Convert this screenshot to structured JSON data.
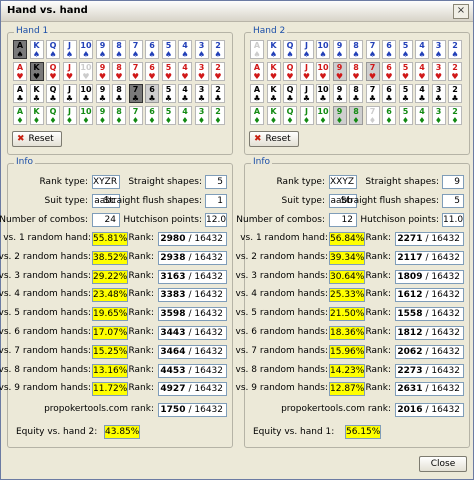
{
  "window": {
    "title": "Hand vs. hand",
    "close_glyph": "×",
    "close_label": "Close"
  },
  "hand1": {
    "label": "Hand 1",
    "reset_label": "Reset",
    "rows": [
      {
        "suit": "♠",
        "color": "blu",
        "cards": [
          "A",
          "K",
          "Q",
          "J",
          "10",
          "9",
          "8",
          "7",
          "6",
          "5",
          "4",
          "3",
          "2"
        ],
        "sel": [
          0
        ],
        "dim": [],
        "light": []
      },
      {
        "suit": "♥",
        "color": "red",
        "cards": [
          "A",
          "K",
          "Q",
          "J",
          "10",
          "9",
          "8",
          "7",
          "6",
          "5",
          "4",
          "3",
          "2"
        ],
        "sel": [
          1
        ],
        "dim": [],
        "light": [
          4
        ]
      },
      {
        "suit": "♣",
        "color": "blk",
        "cards": [
          "A",
          "K",
          "Q",
          "J",
          "10",
          "9",
          "8",
          "7",
          "6",
          "5",
          "4",
          "3",
          "2"
        ],
        "sel": [
          7
        ],
        "dim": [
          8
        ],
        "light": []
      },
      {
        "suit": "♦",
        "color": "grn",
        "cards": [
          "A",
          "K",
          "Q",
          "J",
          "10",
          "9",
          "8",
          "7",
          "6",
          "5",
          "4",
          "3",
          "2"
        ],
        "sel": [],
        "dim": [],
        "light": []
      }
    ]
  },
  "hand2": {
    "label": "Hand 2",
    "reset_label": "Reset",
    "rows": [
      {
        "suit": "♠",
        "color": "blu",
        "cards": [
          "A",
          "K",
          "Q",
          "J",
          "10",
          "9",
          "8",
          "7",
          "6",
          "5",
          "4",
          "3",
          "2"
        ],
        "sel": [],
        "dim": [],
        "light": [
          0
        ]
      },
      {
        "suit": "♥",
        "color": "red",
        "cards": [
          "A",
          "K",
          "Q",
          "J",
          "10",
          "9",
          "8",
          "7",
          "6",
          "5",
          "4",
          "3",
          "2"
        ],
        "sel": [],
        "dim": [
          5,
          7
        ],
        "light": []
      },
      {
        "suit": "♣",
        "color": "blk",
        "cards": [
          "A",
          "K",
          "Q",
          "J",
          "10",
          "9",
          "8",
          "7",
          "6",
          "5",
          "4",
          "3",
          "2"
        ],
        "sel": [],
        "dim": [],
        "light": []
      },
      {
        "suit": "♦",
        "color": "grn",
        "cards": [
          "A",
          "K",
          "Q",
          "J",
          "10",
          "9",
          "8",
          "7",
          "6",
          "5",
          "4",
          "3",
          "2"
        ],
        "sel": [],
        "dim": [
          5,
          6
        ],
        "light": [
          7
        ]
      }
    ]
  },
  "info1": {
    "label": "Info",
    "rank_type_label": "Rank type:",
    "rank_type": "XYZR",
    "suit_type_label": "Suit type:",
    "suit_type": "aabc",
    "combos_label": "Number of combos:",
    "combos": "24",
    "straight_label": "Straight shapes:",
    "straight": "5",
    "sflush_label": "Straight flush shapes:",
    "sflush": "1",
    "hutch_label": "Hutchison points:",
    "hutch": "12.0",
    "rank_label": "Rank:",
    "rows": [
      {
        "label": "vs. 1 random hand:",
        "pct": "55.81%",
        "rank": "2980",
        "of": "/ 16432"
      },
      {
        "label": "vs. 2 random hands:",
        "pct": "38.52%",
        "rank": "2938",
        "of": "/ 16432"
      },
      {
        "label": "vs. 3 random hands:",
        "pct": "29.22%",
        "rank": "3163",
        "of": "/ 16432"
      },
      {
        "label": "vs. 4 random hands:",
        "pct": "23.48%",
        "rank": "3383",
        "of": "/ 16432"
      },
      {
        "label": "vs. 5 random hands:",
        "pct": "19.65%",
        "rank": "3598",
        "of": "/ 16432"
      },
      {
        "label": "vs. 6 random hands:",
        "pct": "17.07%",
        "rank": "3443",
        "of": "/ 16432"
      },
      {
        "label": "vs. 7 random hands:",
        "pct": "15.25%",
        "rank": "3464",
        "of": "/ 16432"
      },
      {
        "label": "vs. 8 random hands:",
        "pct": "13.16%",
        "rank": "4453",
        "of": "/ 16432"
      },
      {
        "label": "vs. 9 random hands:",
        "pct": "11.72%",
        "rank": "4927",
        "of": "/ 16432"
      }
    ],
    "pt_label": "propokertools.com rank:",
    "pt_rank": "1750",
    "pt_of": "/ 16432",
    "equity_label": "Equity vs. hand 2:",
    "equity": "43.85%"
  },
  "info2": {
    "label": "Info",
    "rank_type_label": "Rank type:",
    "rank_type": "XXYZ",
    "suit_type_label": "Suit type:",
    "suit_type": "aabb",
    "combos_label": "Number of combos:",
    "combos": "12",
    "straight_label": "Straight shapes:",
    "straight": "9",
    "sflush_label": "Straight flush shapes:",
    "sflush": "5",
    "hutch_label": "Hutchison points:",
    "hutch": "11.0",
    "rank_label": "Rank:",
    "rows": [
      {
        "label": "vs. 1 random hand:",
        "pct": "56.84%",
        "rank": "2271",
        "of": "/ 16432"
      },
      {
        "label": "vs. 2 random hands:",
        "pct": "39.34%",
        "rank": "2117",
        "of": "/ 16432"
      },
      {
        "label": "vs. 3 random hands:",
        "pct": "30.64%",
        "rank": "1809",
        "of": "/ 16432"
      },
      {
        "label": "vs. 4 random hands:",
        "pct": "25.33%",
        "rank": "1612",
        "of": "/ 16432"
      },
      {
        "label": "vs. 5 random hands:",
        "pct": "21.50%",
        "rank": "1558",
        "of": "/ 16432"
      },
      {
        "label": "vs. 6 random hands:",
        "pct": "18.36%",
        "rank": "1812",
        "of": "/ 16432"
      },
      {
        "label": "vs. 7 random hands:",
        "pct": "15.96%",
        "rank": "2062",
        "of": "/ 16432"
      },
      {
        "label": "vs. 8 random hands:",
        "pct": "14.23%",
        "rank": "2273",
        "of": "/ 16432"
      },
      {
        "label": "vs. 9 random hands:",
        "pct": "12.87%",
        "rank": "2631",
        "of": "/ 16432"
      }
    ],
    "pt_label": "propokertools.com rank:",
    "pt_rank": "2016",
    "pt_of": "/ 16432",
    "equity_label": "Equity vs. hand 1:",
    "equity": "56.15%"
  }
}
